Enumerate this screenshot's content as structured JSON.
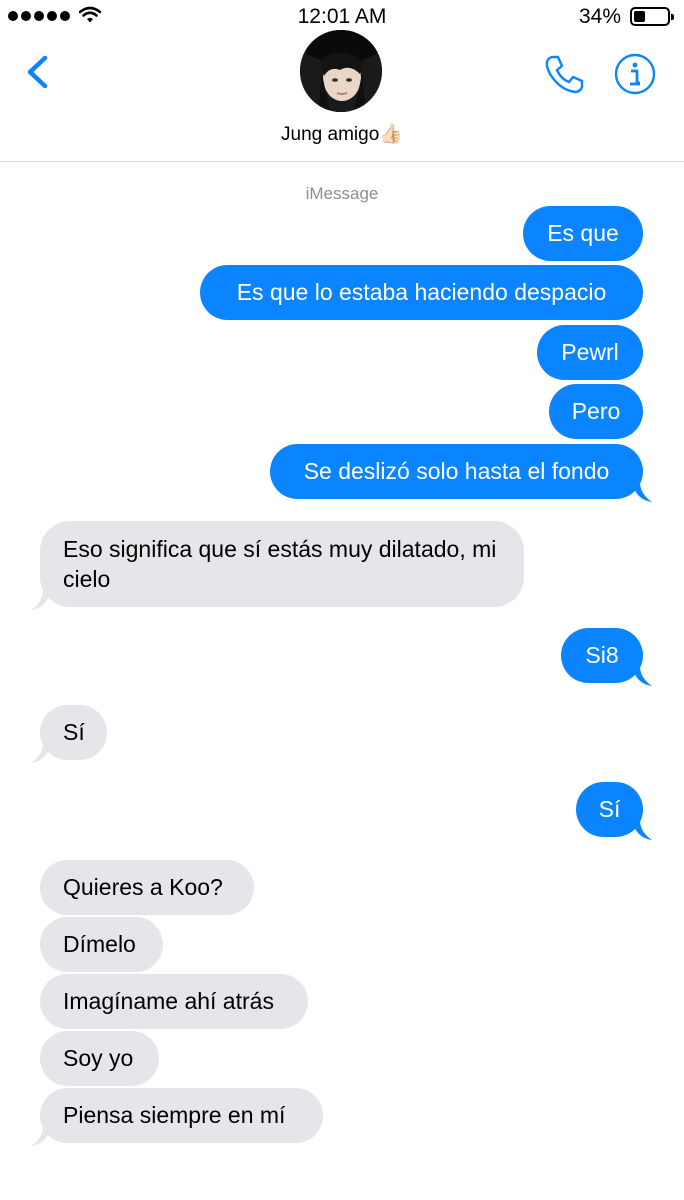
{
  "status_bar": {
    "time": "12:01 AM",
    "battery_percent": "34%",
    "battery_level": 0.34,
    "signal_bars": 5,
    "wifi_icon": "wifi-icon"
  },
  "header": {
    "contact_name": "Jung amigo👍🏻",
    "back_icon": "chevron-left-icon",
    "phone_icon": "phone-icon",
    "info_icon": "info-icon",
    "accent_color": "#0b84ff"
  },
  "thread": {
    "service_label": "iMessage",
    "outgoing_color": "#0b84ff",
    "incoming_color": "#e5e5ea",
    "messages": [
      {
        "from": "me",
        "text": "Es que"
      },
      {
        "from": "me",
        "text": "Es que lo estaba haciendo despacio"
      },
      {
        "from": "me",
        "text": "Pewrl"
      },
      {
        "from": "me",
        "text": "Pero"
      },
      {
        "from": "me",
        "text": "Se deslizó solo hasta el fondo"
      },
      {
        "from": "them",
        "text": "Eso significa que sí estás muy dilatado, mi cielo"
      },
      {
        "from": "me",
        "text": "Si8"
      },
      {
        "from": "them",
        "text": "Sí"
      },
      {
        "from": "me",
        "text": "Sí"
      },
      {
        "from": "them",
        "text": "Quieres a Koo?"
      },
      {
        "from": "them",
        "text": "Dímelo"
      },
      {
        "from": "them",
        "text": "Imagíname ahí atrás"
      },
      {
        "from": "them",
        "text": "Soy yo"
      },
      {
        "from": "them",
        "text": "Piensa siempre en mí"
      }
    ]
  }
}
